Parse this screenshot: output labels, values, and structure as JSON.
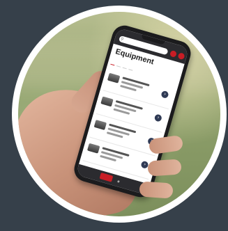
{
  "app": {
    "screen_title": "Equipment"
  },
  "tabs": [
    {
      "label": ""
    },
    {
      "label": ""
    },
    {
      "label": ""
    },
    {
      "label": ""
    }
  ],
  "colors": {
    "background": "#36404a",
    "ring": "#ffffff",
    "accent": "#c81d25",
    "item_button": "#2f3a55"
  },
  "icons": {
    "search": "search-icon",
    "item_action": "chevron-right-icon"
  }
}
